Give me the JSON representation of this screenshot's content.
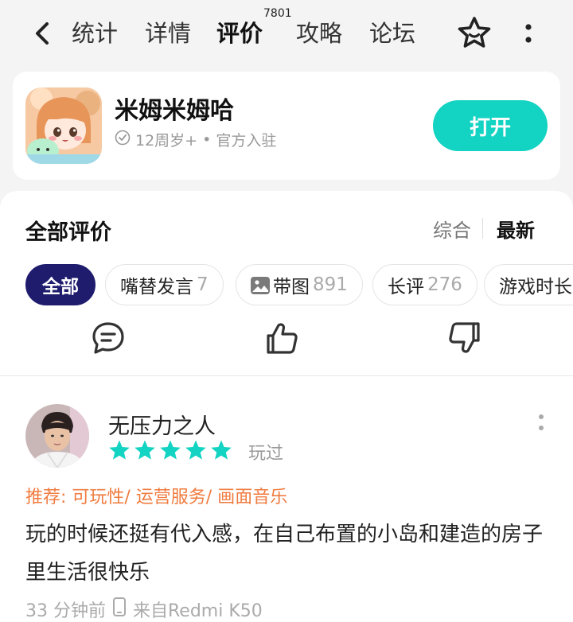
{
  "nav": {
    "tabs": [
      {
        "label": "统计"
      },
      {
        "label": "详情"
      },
      {
        "label": "评价"
      },
      {
        "label": "攻略"
      },
      {
        "label": "论坛"
      }
    ],
    "active_tab": "评价",
    "review_count_badge": "7801"
  },
  "app": {
    "name": "米姆米姆哈",
    "age_rating": "12周岁+",
    "separator": "•",
    "status": "官方入驻",
    "open_label": "打开"
  },
  "reviews": {
    "section_title": "全部评价",
    "sort": {
      "option_1": "综合",
      "option_2": "最新"
    },
    "filters": [
      {
        "label": "全部",
        "count": ""
      },
      {
        "label": "嘴替发言",
        "count": "7"
      },
      {
        "label": "带图",
        "count": "891"
      },
      {
        "label": "长评",
        "count": "276"
      },
      {
        "label": "游戏时长",
        "count": ""
      }
    ],
    "reactions": [
      "comment-icon",
      "thumbs-up-icon",
      "thumbs-down-icon"
    ],
    "items": [
      {
        "username": "无压力之人",
        "rating": 5,
        "played_label": "玩过",
        "tags": "推荐: 可玩性/ 运营服务/ 画面音乐",
        "text": "玩的时候还挺有代入感，在自己布置的小岛和建造的房子里生活很快乐",
        "time": "33 分钟前",
        "device": "来自Redmi  K50"
      }
    ]
  },
  "colors": {
    "accent": "#13d3c2",
    "chip_active": "#1f1c6e",
    "tag_orange": "#f07b3f"
  }
}
